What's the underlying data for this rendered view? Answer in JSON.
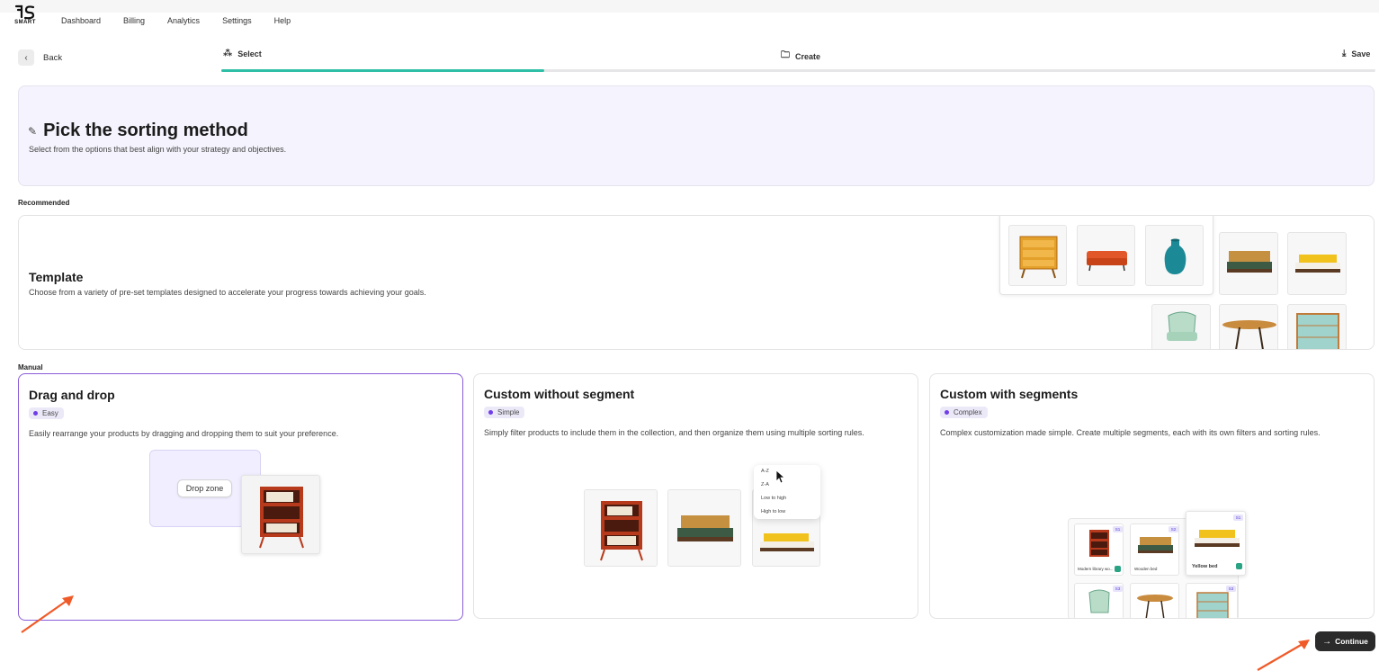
{
  "brand": {
    "logo_text": "SMART"
  },
  "nav": {
    "items": [
      "Dashboard",
      "Billing",
      "Analytics",
      "Settings",
      "Help"
    ]
  },
  "back": {
    "label": "Back",
    "icon": "chevron-left-icon"
  },
  "steps": [
    {
      "label": "Select",
      "icon": "sparkle-icon"
    },
    {
      "label": "Create",
      "icon": "folder-plus-icon"
    },
    {
      "label": "Save",
      "icon": "download-icon"
    }
  ],
  "progress": {
    "current_step": 1,
    "total_steps": 3,
    "fill_fraction": 0.28,
    "color": "#2fbfa6"
  },
  "header": {
    "title": "Pick the sorting method",
    "subtitle": "Select from the options that best align with your strategy and objectives."
  },
  "sections": {
    "recommended": "Recommended",
    "manual": "Manual"
  },
  "template_card": {
    "title": "Template",
    "description": "Choose from a variety of pre-set templates designed to accelerate your progress towards achieving your goals."
  },
  "manual_cards": [
    {
      "title": "Drag and drop",
      "badge": "Easy",
      "description": "Easily rearrange your products by dragging and dropping them to suit your preference.",
      "drop_zone_label": "Drop zone",
      "selected": true
    },
    {
      "title": "Custom without segment",
      "badge": "Simple",
      "description": "Simply filter products to include them in the collection, and then organize them using multiple sorting rules.",
      "sort_options": [
        "A-Z",
        "Z-A",
        "Low to high",
        "High to low"
      ]
    },
    {
      "title": "Custom with segments",
      "badge": "Complex",
      "description": "Complex customization made simple. Create multiple segments, each with its own filters and sorting rules.",
      "segments": [
        {
          "num": "S1",
          "label": "Modern library wo..."
        },
        {
          "num": "S2",
          "label": "Wooden bed"
        },
        {
          "num": "S1",
          "label": "Yellow bed"
        },
        {
          "num": "S3",
          "label": ""
        },
        {
          "num": "S3",
          "label": ""
        }
      ]
    }
  ],
  "continue": {
    "label": "Continue",
    "icon": "arrow-right-icon"
  },
  "colors": {
    "accent": "#6f3ee8",
    "selected_border": "#8a5cd8",
    "annotation_arrow": "#f05a28",
    "hero_bg": "#f5f4fe"
  }
}
